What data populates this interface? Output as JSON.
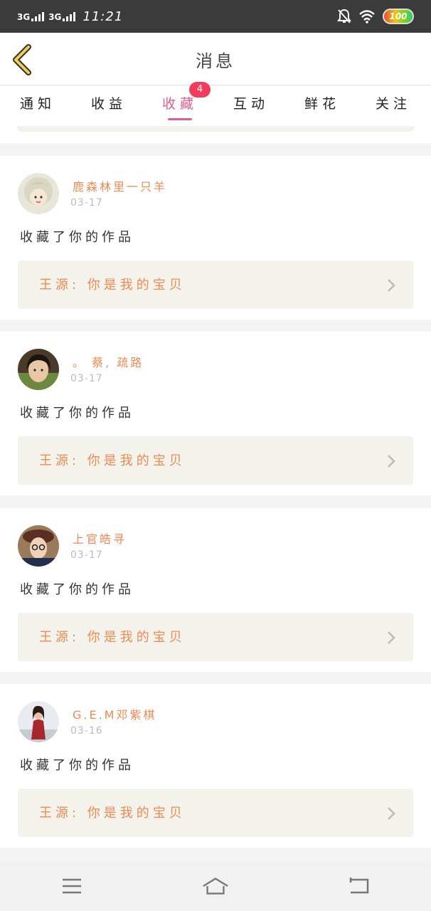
{
  "status_bar": {
    "network_1": "3G",
    "network_2": "3G",
    "time": "11:21",
    "battery": "100",
    "icons": [
      "signal-icon",
      "signal-icon",
      "mute-bell-icon",
      "wifi-icon",
      "battery-icon"
    ]
  },
  "header": {
    "title": "消息",
    "back_icon": "chevron-left-icon"
  },
  "tabs": [
    {
      "label": "通知",
      "active": false
    },
    {
      "label": "收益",
      "active": false
    },
    {
      "label": "收藏",
      "active": true,
      "badge": "4"
    },
    {
      "label": "互动",
      "active": false
    },
    {
      "label": "鲜花",
      "active": false
    },
    {
      "label": "关注",
      "active": false
    }
  ],
  "feed": [
    {
      "user": "鹿森林里一只羊",
      "date": "03-17",
      "action": "收藏了你的作品",
      "work": "王源: 你是我的宝贝"
    },
    {
      "user": "。 蔡, 疏路",
      "date": "03-17",
      "action": "收藏了你的作品",
      "work": "王源: 你是我的宝贝"
    },
    {
      "user": "上官皓寻",
      "date": "03-17",
      "action": "收藏了你的作品",
      "work": "王源: 你是我的宝贝"
    },
    {
      "user": "G.E.M邓紫棋",
      "date": "03-16",
      "action": "收藏了你的作品",
      "work": "王源: 你是我的宝贝"
    }
  ],
  "colors": {
    "accent": "#e05d8e",
    "username": "#ee8a55",
    "badge": "#f23d5a",
    "work_bg": "#f3f3ec"
  },
  "nav": {
    "icons": [
      "menu-icon",
      "home-icon",
      "back-icon"
    ]
  }
}
